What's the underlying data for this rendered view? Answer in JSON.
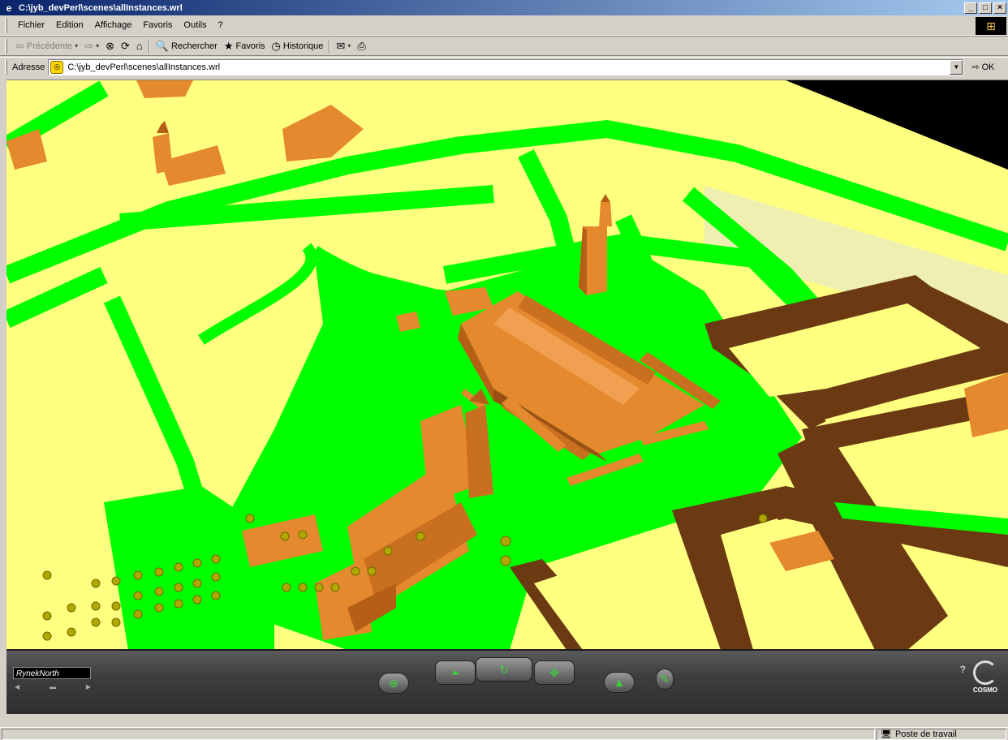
{
  "window": {
    "title": "C:\\jyb_devPerl\\scenes\\allInstances.wrl",
    "app_icon": "ie-icon",
    "buttons": {
      "minimize": "_",
      "maximize": "□",
      "close": "×"
    }
  },
  "menu": {
    "items": [
      "Fichier",
      "Edition",
      "Affichage",
      "Favoris",
      "Outils",
      "?"
    ]
  },
  "toolbar": {
    "back_label": "Précédente",
    "forward_label": "",
    "search_label": "Rechercher",
    "favorites_label": "Favoris",
    "history_label": "Historique"
  },
  "address": {
    "label": "Adresse",
    "value": "C:\\jyb_devPerl\\scenes\\allInstances.wrl",
    "go_label": "OK"
  },
  "viewer": {
    "viewpoint_name": "RynekNorth",
    "brand": "COSMO",
    "colors": {
      "ground": "#ffff80",
      "grass": "#00ff00",
      "buildings": "#e5892f",
      "walls": "#6b3a12",
      "sky": "#000000"
    }
  },
  "status": {
    "zone": "Poste de travail"
  }
}
